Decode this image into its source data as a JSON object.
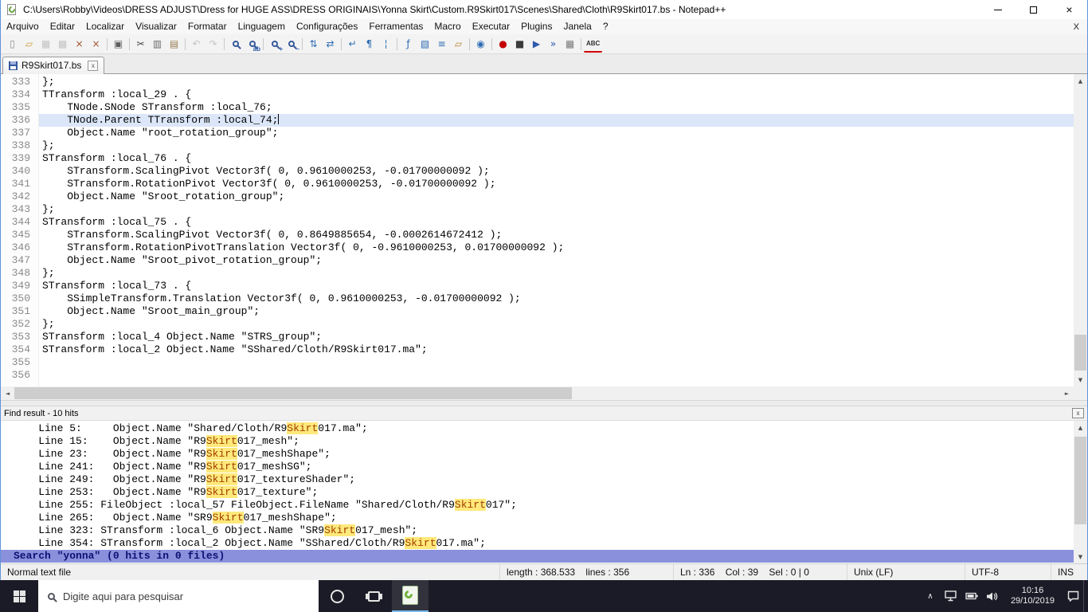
{
  "window": {
    "title": "C:\\Users\\Robby\\Videos\\DRESS ADJUST\\Dress for HUGE ASS\\DRESS ORIGINAIS\\Yonna Skirt\\Custom.R9Skirt017\\Scenes\\Shared\\Cloth\\R9Skirt017.bs - Notepad++",
    "menubar_close": "X"
  },
  "glyphs": {
    "close": "×",
    "small_close": "x",
    "scroll_up": "▲",
    "scroll_down": "▼",
    "scroll_left": "◄",
    "scroll_right": "►",
    "chevron_up": "∧"
  },
  "menu": {
    "items": [
      "Arquivo",
      "Editar",
      "Localizar",
      "Visualizar",
      "Formatar",
      "Linguagem",
      "Configurações",
      "Ferramentas",
      "Macro",
      "Executar",
      "Plugins",
      "Janela",
      "?"
    ]
  },
  "toolbar": {
    "icons": [
      {
        "name": "new-file-icon",
        "glyph": "▯",
        "color": "#8c8c8c"
      },
      {
        "name": "open-folder-icon",
        "glyph": "▱",
        "color": "#d29a38"
      },
      {
        "name": "save-icon",
        "glyph": "▦",
        "color": "#b4b4b4",
        "disabled": true
      },
      {
        "name": "save-all-icon",
        "glyph": "▩",
        "color": "#b4b4b4",
        "disabled": true
      },
      {
        "name": "close-file-icon",
        "glyph": "×",
        "color": "#a0522d"
      },
      {
        "name": "close-all-icon",
        "glyph": "×",
        "color": "#a0522d"
      },
      {
        "name": "print-icon",
        "glyph": "▣",
        "color": "#5f5f5f",
        "sep": true
      },
      {
        "name": "cut-icon",
        "glyph": "✂",
        "color": "#4a4a4a",
        "sep": true
      },
      {
        "name": "copy-icon",
        "glyph": "▥",
        "color": "#6a6a6a"
      },
      {
        "name": "paste-icon",
        "glyph": "▤",
        "color": "#9a7b4f"
      },
      {
        "name": "undo-icon",
        "glyph": "↶",
        "color": "#b4b4b4",
        "sep": true,
        "disabled": true
      },
      {
        "name": "redo-icon",
        "glyph": "↷",
        "color": "#b4b4b4",
        "disabled": true
      },
      {
        "name": "find-icon",
        "type": "lens",
        "sep": true
      },
      {
        "name": "replace-icon",
        "type": "lens",
        "badge": "ab"
      },
      {
        "name": "zoom-in-icon",
        "type": "lens",
        "badge": "+",
        "sep": true
      },
      {
        "name": "zoom-out-icon",
        "type": "lens",
        "badge": "–"
      },
      {
        "name": "sync-vertical-icon",
        "glyph": "⇅",
        "color": "#2e6db4",
        "sep": true
      },
      {
        "name": "sync-horizontal-icon",
        "glyph": "⇄",
        "color": "#2e6db4"
      },
      {
        "name": "word-wrap-icon",
        "glyph": "↵",
        "color": "#2e6db4",
        "sep": true
      },
      {
        "name": "show-all-chars-icon",
        "glyph": "¶",
        "color": "#2e6db4"
      },
      {
        "name": "indent-guide-icon",
        "glyph": "¦",
        "color": "#2e6db4"
      },
      {
        "name": "function-list-icon",
        "glyph": "ƒ",
        "color": "#2e6db4",
        "sep": true
      },
      {
        "name": "doc-map-icon",
        "glyph": "▧",
        "color": "#2e6db4"
      },
      {
        "name": "doc-list-icon",
        "glyph": "≡",
        "color": "#2e6db4"
      },
      {
        "name": "folder-workspace-icon",
        "glyph": "▱",
        "color": "#b8862f"
      },
      {
        "name": "monitoring-icon",
        "glyph": "◉",
        "color": "#2e6db4",
        "sep": true
      },
      {
        "name": "record-macro-icon",
        "glyph": "●",
        "color": "#c40000",
        "sep": true
      },
      {
        "name": "stop-macro-icon",
        "glyph": "■",
        "color": "#3a3a3a"
      },
      {
        "name": "play-macro-icon",
        "glyph": "▶",
        "color": "#2e5aac"
      },
      {
        "name": "run-multiple-icon",
        "glyph": "»",
        "color": "#2e5aac"
      },
      {
        "name": "save-macro-icon",
        "glyph": "▦",
        "color": "#7a7a7a"
      },
      {
        "name": "spell-check-icon",
        "type": "abc",
        "glyph": "ABC",
        "sep": true
      }
    ]
  },
  "tab": {
    "label": "R9Skirt017.bs"
  },
  "editor": {
    "current_line": 336,
    "lines": [
      {
        "num": 333,
        "text": "};"
      },
      {
        "num": 334,
        "text": "TTransform :local_29 . {"
      },
      {
        "num": 335,
        "text": "    TNode.SNode STransform :local_76;"
      },
      {
        "num": 336,
        "text": "    TNode.Parent TTransform :local_74;"
      },
      {
        "num": 337,
        "text": "    Object.Name \"root_rotation_group\";"
      },
      {
        "num": 338,
        "text": "};"
      },
      {
        "num": 339,
        "text": "STransform :local_76 . {"
      },
      {
        "num": 340,
        "text": "    STransform.ScalingPivot Vector3f( 0, 0.9610000253, -0.01700000092 );"
      },
      {
        "num": 341,
        "text": "    STransform.RotationPivot Vector3f( 0, 0.9610000253, -0.01700000092 );"
      },
      {
        "num": 342,
        "text": "    Object.Name \"Sroot_rotation_group\";"
      },
      {
        "num": 343,
        "text": "};"
      },
      {
        "num": 344,
        "text": "STransform :local_75 . {"
      },
      {
        "num": 345,
        "text": "    STransform.ScalingPivot Vector3f( 0, 0.8649885654, -0.0002614672412 );"
      },
      {
        "num": 346,
        "text": "    STransform.RotationPivotTranslation Vector3f( 0, -0.9610000253, 0.01700000092 );"
      },
      {
        "num": 347,
        "text": "    Object.Name \"Sroot_pivot_rotation_group\";"
      },
      {
        "num": 348,
        "text": "};"
      },
      {
        "num": 349,
        "text": "STransform :local_73 . {"
      },
      {
        "num": 350,
        "text": "    SSimpleTransform.Translation Vector3f( 0, 0.9610000253, -0.01700000092 );"
      },
      {
        "num": 351,
        "text": "    Object.Name \"Sroot_main_group\";"
      },
      {
        "num": 352,
        "text": "};"
      },
      {
        "num": 353,
        "text": "STransform :local_4 Object.Name \"STRS_group\";"
      },
      {
        "num": 354,
        "text": "STransform :local_2 Object.Name \"SShared/Cloth/R9Skirt017.ma\";"
      },
      {
        "num": 355,
        "text": ""
      },
      {
        "num": 356,
        "text": ""
      }
    ]
  },
  "find_results": {
    "header": "Find result - 10 hits",
    "match_word": "Skirt",
    "lines": [
      "    Line 5:     Object.Name \"Shared/Cloth/R9Skirt017.ma\";",
      "    Line 15:    Object.Name \"R9Skirt017_mesh\";",
      "    Line 23:    Object.Name \"R9Skirt017_meshShape\";",
      "    Line 241:   Object.Name \"R9Skirt017_meshSG\";",
      "    Line 249:   Object.Name \"R9Skirt017_textureShader\";",
      "    Line 253:   Object.Name \"R9Skirt017_texture\";",
      "    Line 255: FileObject :local_57 FileObject.FileName \"Shared/Cloth/R9Skirt017\";",
      "    Line 265:   Object.Name \"SR9Skirt017_meshShape\";",
      "    Line 323: STransform :local_6 Object.Name \"SR9Skirt017_mesh\";",
      "    Line 354: STransform :local_2 Object.Name \"SShared/Cloth/R9Skirt017.ma\";"
    ],
    "footer": "Search \"yonna\" (0 hits in 0 files)"
  },
  "status_bar": {
    "doc_type": "Normal text file",
    "length_info": "length : 368.533    lines : 356",
    "position_info": "Ln : 336    Col : 39    Sel : 0 | 0",
    "eol": "Unix (LF)",
    "encoding": "UTF-8",
    "insert_mode": "INS"
  },
  "taskbar": {
    "search_placeholder": "Digite aqui para pesquisar",
    "time": "10:16",
    "date": "29/10/2019"
  }
}
